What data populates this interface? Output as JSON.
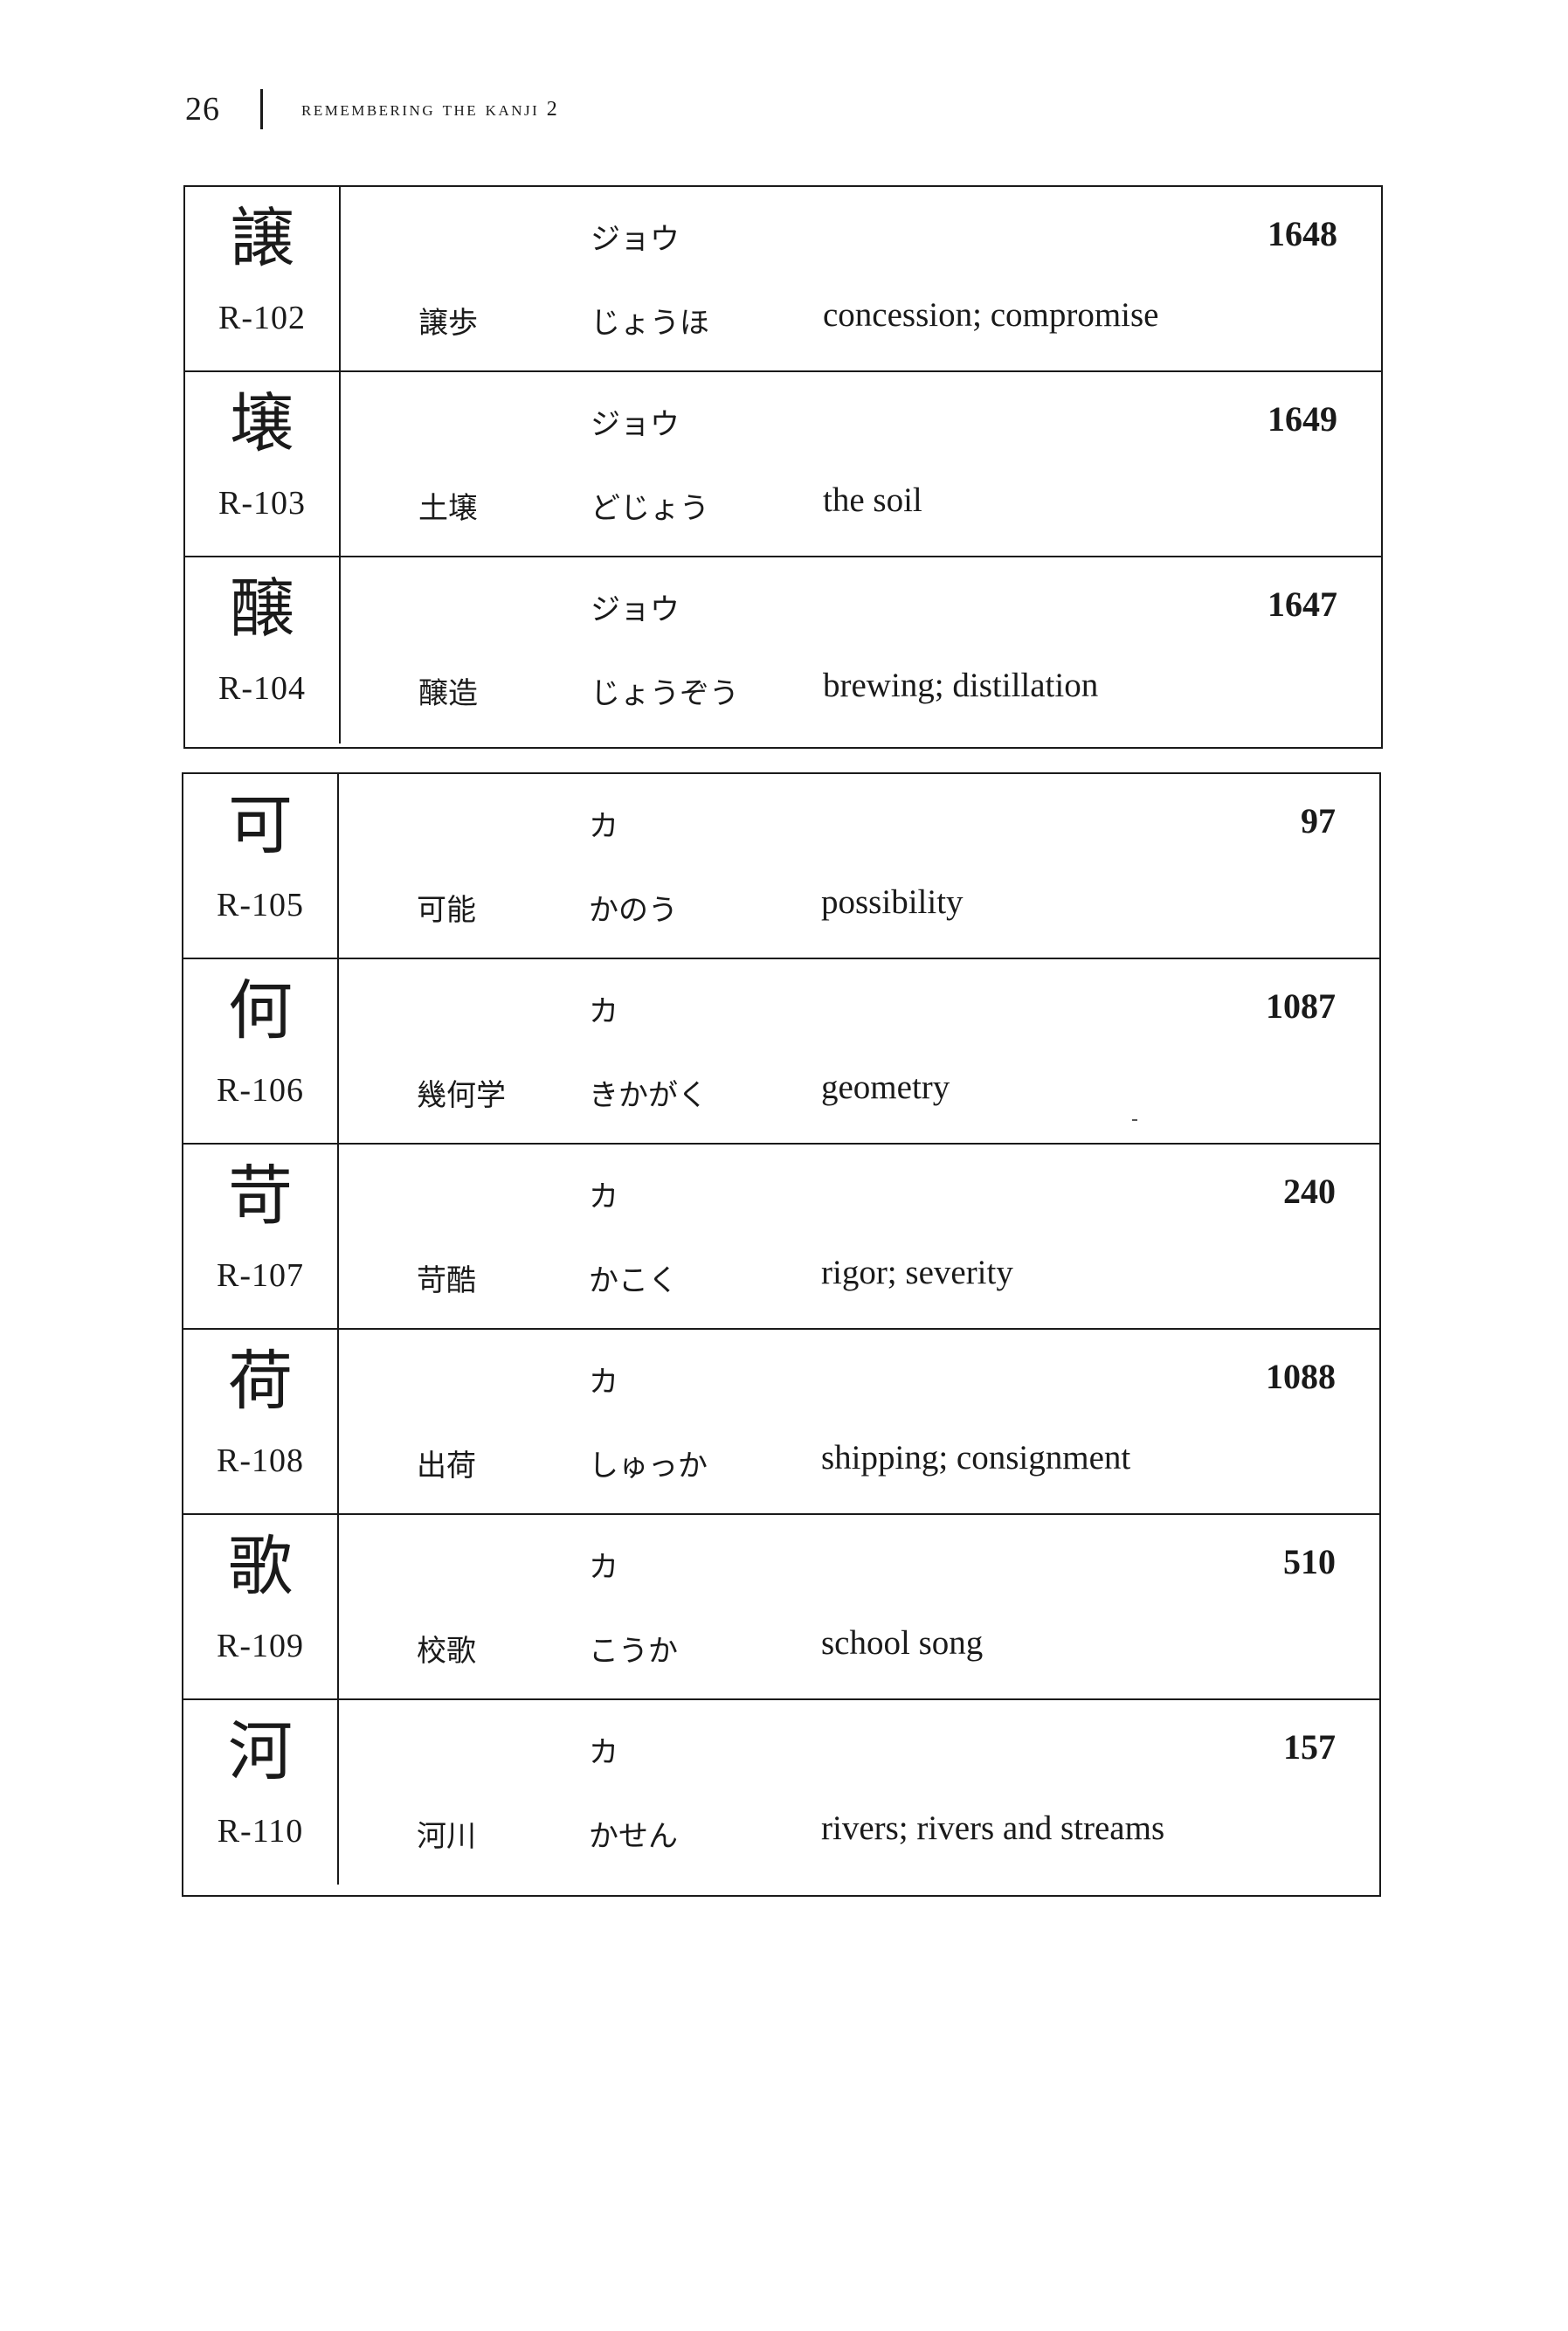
{
  "header": {
    "page_number": "26",
    "running_title": "REMEMBERING THE KANJI 2"
  },
  "tables": [
    {
      "entries": [
        {
          "kanji": "譲",
          "id": "R-102",
          "reading": "ジョウ",
          "frame": "1648",
          "word": "譲歩",
          "kana": "じょうほ",
          "meaning": "concession; compromise"
        },
        {
          "kanji": "壌",
          "id": "R-103",
          "reading": "ジョウ",
          "frame": "1649",
          "word": "土壌",
          "kana": "どじょう",
          "meaning": "the soil"
        },
        {
          "kanji": "醸",
          "id": "R-104",
          "reading": "ジョウ",
          "frame": "1647",
          "word": "醸造",
          "kana": "じょうぞう",
          "meaning": "brewing; distillation"
        }
      ]
    },
    {
      "entries": [
        {
          "kanji": "可",
          "id": "R-105",
          "reading": "カ",
          "frame": "97",
          "word": "可能",
          "kana": "かのう",
          "meaning": "possibility"
        },
        {
          "kanji": "何",
          "id": "R-106",
          "reading": "カ",
          "frame": "1087",
          "word": "幾何学",
          "kana": "きかがく",
          "meaning": "geometry"
        },
        {
          "kanji": "苛",
          "id": "R-107",
          "reading": "カ",
          "frame": "240",
          "word": "苛酷",
          "kana": "かこく",
          "meaning": "rigor; severity"
        },
        {
          "kanji": "荷",
          "id": "R-108",
          "reading": "カ",
          "frame": "1088",
          "word": "出荷",
          "kana": "しゅっか",
          "meaning": "shipping; consignment"
        },
        {
          "kanji": "歌",
          "id": "R-109",
          "reading": "カ",
          "frame": "510",
          "word": "校歌",
          "kana": "こうか",
          "meaning": "school song"
        },
        {
          "kanji": "河",
          "id": "R-110",
          "reading": "カ",
          "frame": "157",
          "word": "河川",
          "kana": "かせん",
          "meaning": "rivers; rivers and streams"
        }
      ]
    }
  ]
}
